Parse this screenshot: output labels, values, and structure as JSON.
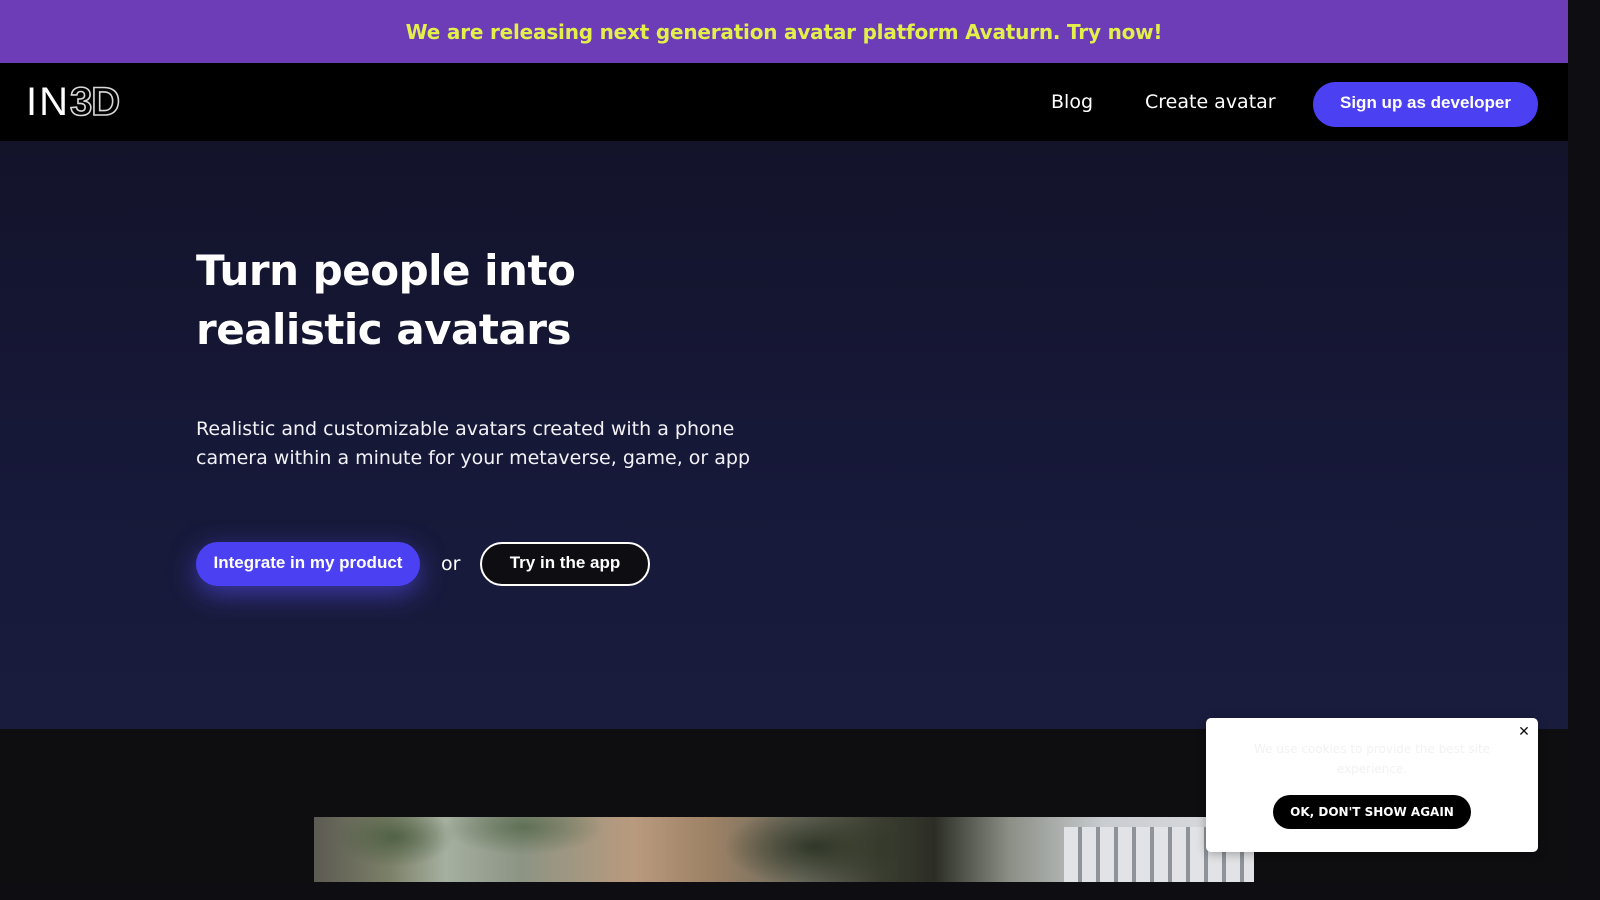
{
  "banner": {
    "text": "We are releasing next generation avatar platform Avaturn. Try now!"
  },
  "nav": {
    "logo_in": "IN",
    "logo_3d": "3D",
    "links": [
      {
        "label": "Blog"
      },
      {
        "label": "Create avatar"
      }
    ],
    "signup_label": "Sign up as developer"
  },
  "hero": {
    "title": "Turn people into realistic avatars",
    "subtitle": "Realistic and customizable avatars created with a phone camera within a minute for your metaverse, game, or app",
    "primary_cta": "Integrate in my product",
    "or_text": "or",
    "secondary_cta": "Try in the app"
  },
  "cookie": {
    "close_glyph": "✕",
    "text": "We use cookies to provide the best site experience.",
    "ok_label": "OK, DON'T SHOW AGAIN"
  },
  "colors": {
    "banner_bg": "#6c3db6",
    "banner_text": "#e4f04a",
    "accent": "#4c40f3",
    "hero_bg": "#17193a"
  },
  "icons": {
    "close": "close-icon"
  }
}
